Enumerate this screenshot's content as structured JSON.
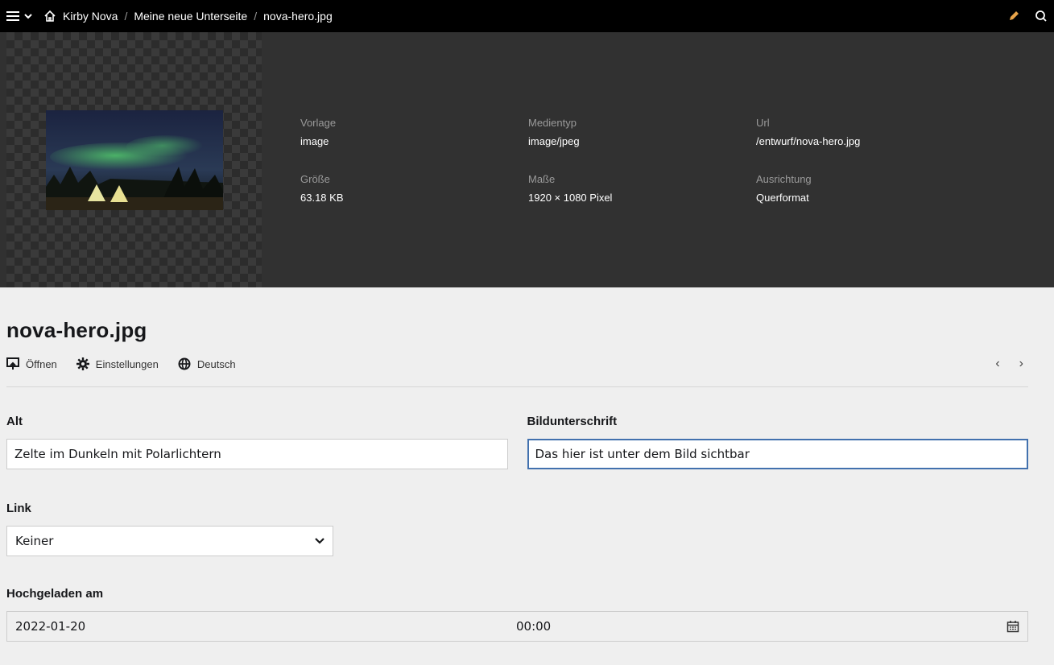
{
  "topbar": {
    "breadcrumbs": [
      "Kirby Nova",
      "Meine neue Unterseite",
      "nova-hero.jpg"
    ],
    "icons": [
      "menu-icon",
      "chevron-down-icon",
      "home-icon",
      "pencil-icon",
      "search-icon"
    ]
  },
  "file_meta": [
    {
      "label": "Vorlage",
      "value": "image"
    },
    {
      "label": "Medientyp",
      "value": "image/jpeg"
    },
    {
      "label": "Url",
      "value": "/entwurf/nova-hero.jpg"
    },
    {
      "label": "Größe",
      "value": "63.18 KB"
    },
    {
      "label": "Maße",
      "value": "1920 × 1080 Pixel"
    },
    {
      "label": "Ausrichtung",
      "value": "Querformat"
    }
  ],
  "title": "nova-hero.jpg",
  "options": {
    "open": "Öffnen",
    "settings": "Einstellungen",
    "language": "Deutsch"
  },
  "fields": {
    "alt": {
      "label": "Alt",
      "value": "Zelte im Dunkeln mit Polarlichtern"
    },
    "caption": {
      "label": "Bildunterschrift",
      "value": "Das hier ist unter dem Bild sichtbar"
    },
    "link": {
      "label": "Link",
      "value": "Keiner"
    },
    "uploaded": {
      "label": "Hochgeladen am",
      "date": "2022-01-20",
      "time": "00:00"
    }
  },
  "colors": {
    "accent": "#e8a349",
    "focus": "#4271ae"
  }
}
